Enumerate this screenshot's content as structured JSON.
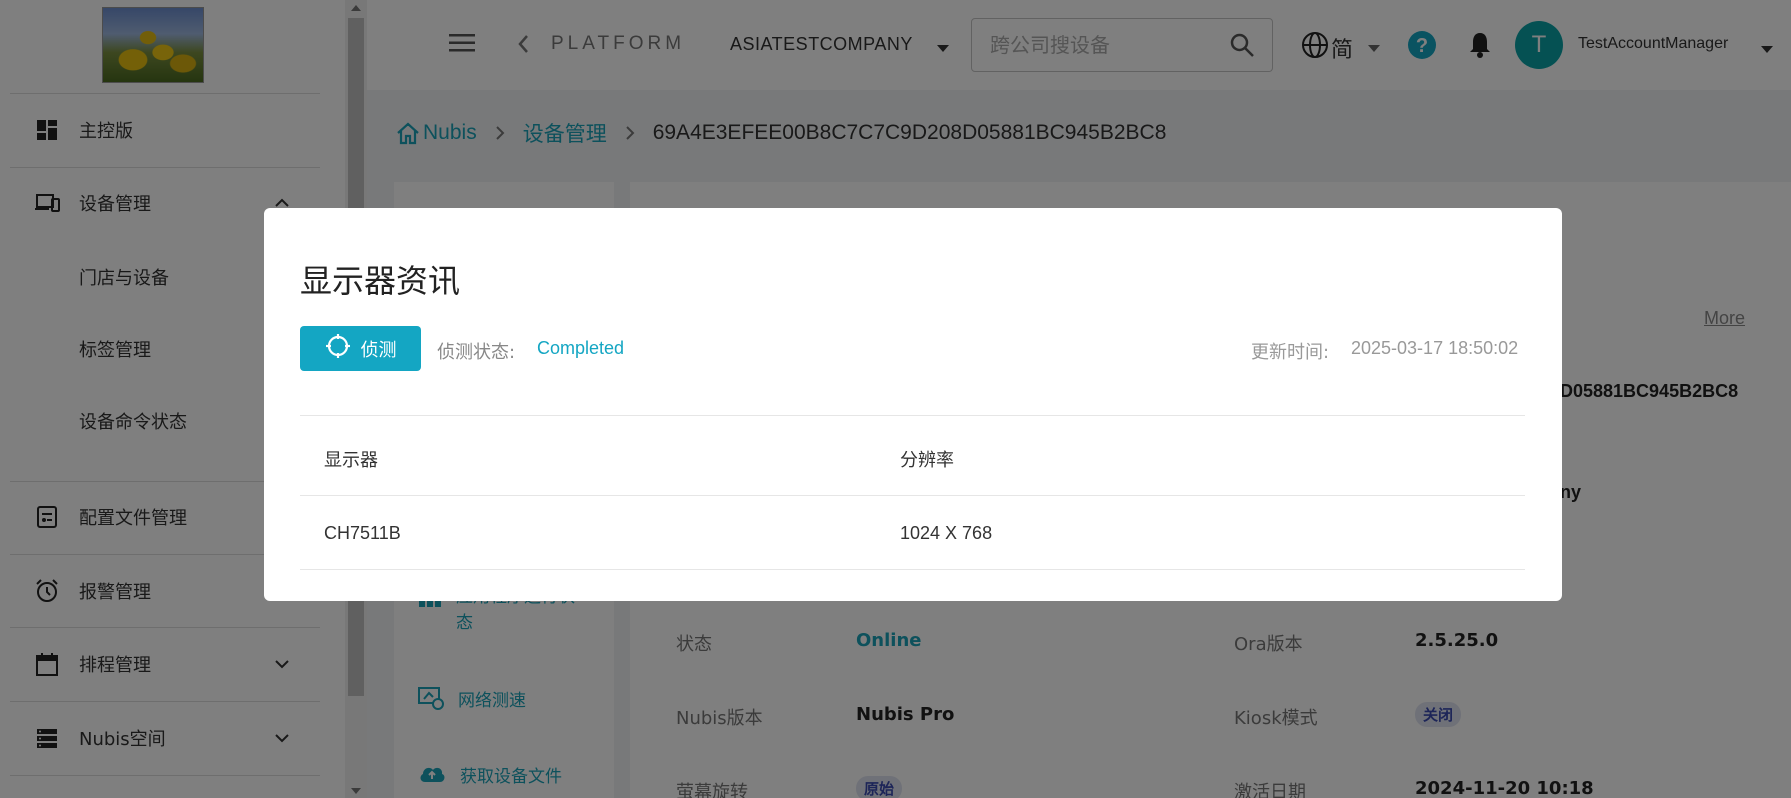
{
  "sidebar": {
    "items": [
      {
        "label": "主控版",
        "icon": "dashboard-icon"
      },
      {
        "label": "设备管理",
        "icon": "devices-icon",
        "expanded": true
      },
      {
        "label": "配置文件管理",
        "icon": "config-file-icon"
      },
      {
        "label": "报警管理",
        "icon": "alarm-clock-icon"
      },
      {
        "label": "排程管理",
        "icon": "calendar-icon"
      },
      {
        "label": "Nubis空间",
        "icon": "storage-icon"
      }
    ],
    "subitems": [
      "门店与设备",
      "标签管理",
      "设备命令状态"
    ]
  },
  "topbar": {
    "platform": "PLATFORM",
    "company": "ASIATESTCOMPANY",
    "search_placeholder": "跨公司搜设备",
    "language": "简",
    "avatar_initial": "T",
    "username": "TestAccountManager"
  },
  "breadcrumb": {
    "home": "Nubis",
    "section": "设备管理",
    "current": "69A4E3EFEE00B8C7C7C9D208D05881BC945B2BC8"
  },
  "background": {
    "more": "More",
    "partial_id": "D05881BC945B2BC8",
    "partial_company": "ny",
    "left_menu": [
      {
        "label": "应用程序运行状态",
        "icon": "apps-icon"
      },
      {
        "label": "网络测速",
        "icon": "speedtest-icon"
      },
      {
        "label": "获取设备文件",
        "icon": "cloud-upload-icon"
      }
    ],
    "rows": [
      {
        "label1": "状态",
        "value1": "Online",
        "label2": "Ora版本",
        "value2": "2.5.25.0"
      },
      {
        "label1": "Nubis版本",
        "value1": "Nubis Pro",
        "label2": "Kiosk模式",
        "value2": "关闭"
      },
      {
        "label1": "萤幕旋转",
        "value1": "原始",
        "label2": "激活日期",
        "value2": "2024-11-20 10:18"
      }
    ]
  },
  "modal": {
    "title": "显示器资讯",
    "detect_button": "侦测",
    "detect_status_label": "侦测状态:",
    "detect_status_value": "Completed",
    "update_time_label": "更新时间:",
    "update_time_value": "2025-03-17 18:50:02",
    "table": {
      "headers": [
        "显示器",
        "分辨率"
      ],
      "rows": [
        [
          "CH7511B",
          "1024 X 768"
        ]
      ]
    }
  },
  "colors": {
    "accent": "#14a6c3",
    "avatar": "#0aa2a6",
    "overlay": "rgba(0,0,0,0.5)"
  }
}
